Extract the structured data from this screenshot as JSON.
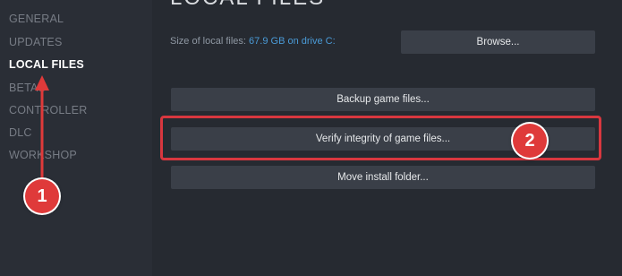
{
  "sidebar": {
    "items": [
      {
        "label": "GENERAL",
        "active": false
      },
      {
        "label": "UPDATES",
        "active": false
      },
      {
        "label": "LOCAL FILES",
        "active": true
      },
      {
        "label": "BETAS",
        "active": false
      },
      {
        "label": "CONTROLLER",
        "active": false
      },
      {
        "label": "DLC",
        "active": false
      },
      {
        "label": "WORKSHOP",
        "active": false
      }
    ]
  },
  "main": {
    "title": "LOCAL FILES",
    "size_label": "Size of local files:",
    "size_value": "67.9 GB on drive C:",
    "browse_label": "Browse...",
    "backup_label": "Backup game files...",
    "verify_label": "Verify integrity of game files...",
    "move_label": "Move install folder..."
  },
  "annotations": {
    "badge1": "1",
    "badge2": "2",
    "accent_color": "#df3a3a"
  }
}
